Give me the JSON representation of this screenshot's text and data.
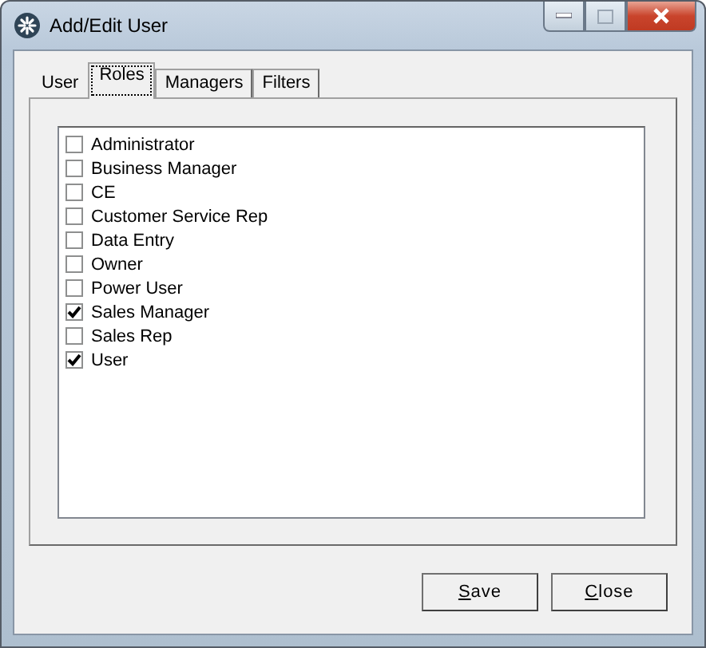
{
  "window": {
    "title": "Add/Edit User"
  },
  "tabs": [
    {
      "label": "User",
      "selected": false
    },
    {
      "label": "Roles",
      "selected": true
    },
    {
      "label": "Managers",
      "selected": false
    },
    {
      "label": "Filters",
      "selected": false
    }
  ],
  "roles": [
    {
      "label": "Administrator",
      "checked": false
    },
    {
      "label": "Business Manager",
      "checked": false
    },
    {
      "label": "CE",
      "checked": false
    },
    {
      "label": "Customer Service Rep",
      "checked": false
    },
    {
      "label": "Data Entry",
      "checked": false
    },
    {
      "label": "Owner",
      "checked": false
    },
    {
      "label": "Power User",
      "checked": false
    },
    {
      "label": "Sales Manager",
      "checked": true
    },
    {
      "label": "Sales Rep",
      "checked": false
    },
    {
      "label": "User",
      "checked": true
    }
  ],
  "buttons": [
    {
      "label": "Save",
      "first_letter_underlined": true
    },
    {
      "label": "Close",
      "first_letter_underlined": true
    }
  ]
}
